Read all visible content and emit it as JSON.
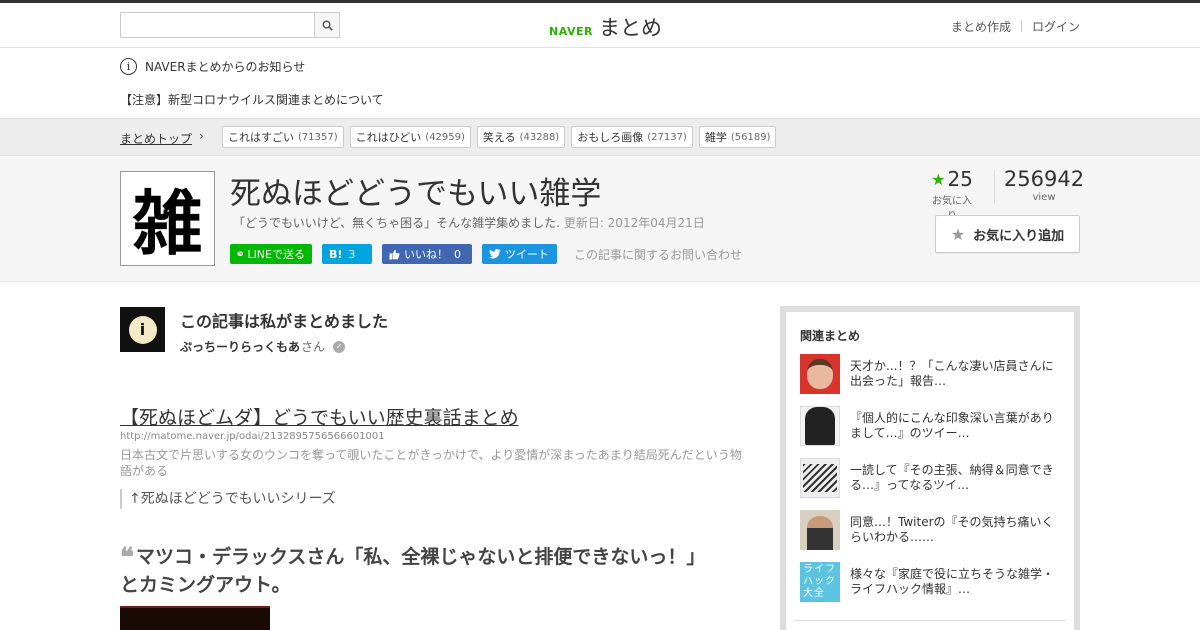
{
  "header": {
    "search": {
      "placeholder": "",
      "value": ""
    },
    "logo_naver": "NAVER",
    "logo_matome": "まとめ",
    "links": {
      "create": "まとめ作成",
      "login": "ログイン"
    }
  },
  "notice": {
    "icon_letter": "i",
    "title": "NAVERまとめからのお知らせ",
    "link": "【注意】新型コロナウイルス関連まとめについて"
  },
  "categories": {
    "top_label": "まとめトップ",
    "chevron": "›",
    "tags": [
      {
        "label": "これはすごい",
        "count": "(71357)"
      },
      {
        "label": "これはひどい",
        "count": "(42959)"
      },
      {
        "label": "笑える",
        "count": "(43288)"
      },
      {
        "label": "おもしろ画像",
        "count": "(27137)"
      },
      {
        "label": "雑学",
        "count": "(56189)"
      }
    ]
  },
  "article": {
    "thumb_char": "雑",
    "title": "死ぬほどどうでもいい雑学",
    "description": "「どうでもいいけど、無くちゃ困る」そんな雑学集めました.",
    "updated": "更新日: 2012年04月21日",
    "share": {
      "line": "LINEで送る",
      "hatena_mark": "B!",
      "hatena_count": "3",
      "facebook": "いいね！",
      "facebook_count": "0",
      "twitter": "ツイート"
    },
    "inquiry": "この記事に関するお問い合わせ",
    "favorites": "25",
    "favorites_label": "お気に入り",
    "views": "256942",
    "views_label": "view",
    "fav_button": "お気に入り追加"
  },
  "author": {
    "avatar_letter": "i",
    "heading": "この記事は私がまとめました",
    "name": "ぷっちーりらっくもあ",
    "suffix": "さん"
  },
  "content": {
    "link_title": "【死ぬほどムダ】どうでもいい歴史裏話まとめ",
    "link_url": "http://matome.naver.jp/odai/2132895756566601001",
    "link_desc": "日本古文で片思いする女のウンコを奪って覗いたことがきっかけで、より愛情が深まったあまり結局死んだという物語がある",
    "note": "↑死ぬほどどうでもいいシリーズ",
    "quote_mark": "❝",
    "heading": "マツコ・デラックスさん「私、全裸じゃないと排便できないっ！」　とカミングアウト。"
  },
  "sidebar": {
    "title": "関連まとめ",
    "items": [
      {
        "text": "天才か...！？「こんな凄い店員さんに出会った」報告…"
      },
      {
        "text": "『個人的にこんな印象深い言葉がありまして…』のツイー…"
      },
      {
        "text": "一読して『その主張、納得＆同意できる…』ってなるツイ…"
      },
      {
        "text": "同意…！Twiterの『その気持ち痛いくらいわかる……"
      },
      {
        "text": "様々な『家庭で役に立ちそうな雑学・ライフハック情報』…",
        "thumb_text": "ライフハック大全"
      }
    ]
  },
  "colors": {
    "naver_green": "#2db400",
    "line_green": "#00b900",
    "hatena_blue": "#00a4de",
    "facebook_blue": "#4267b2",
    "twitter_blue": "#1b95e0"
  }
}
